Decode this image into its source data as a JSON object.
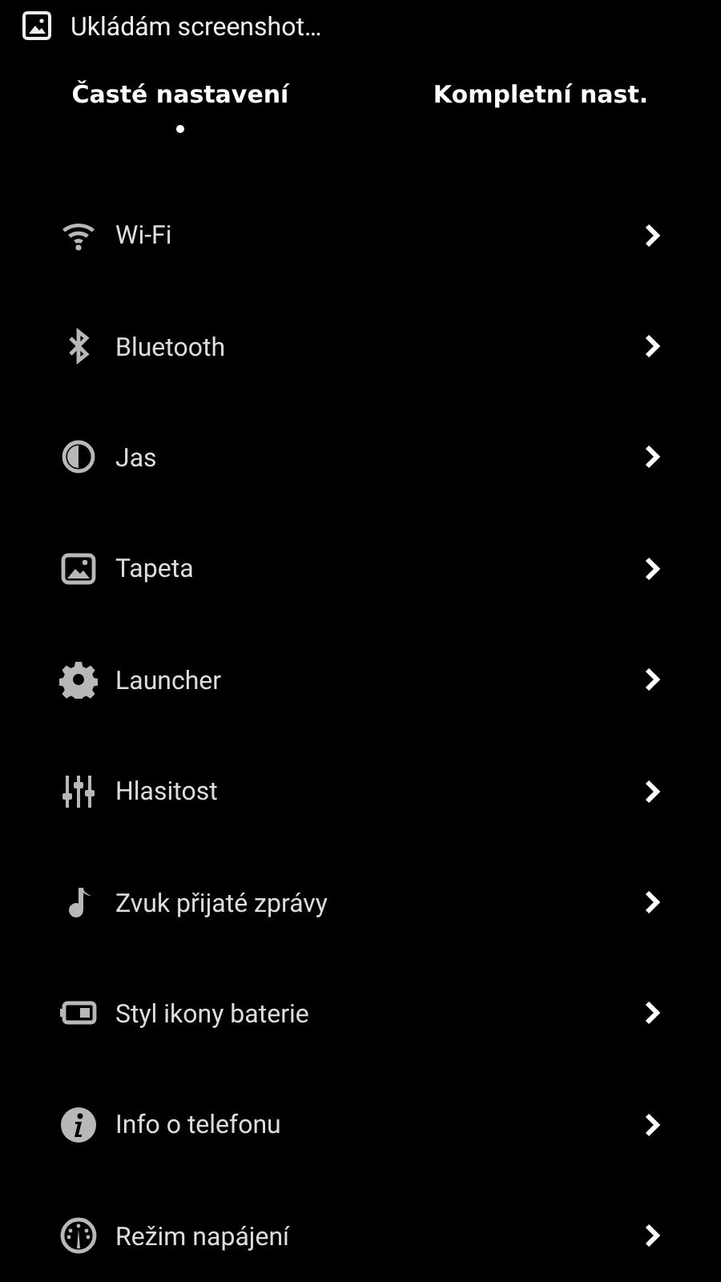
{
  "notification": {
    "text": "Ukládám screenshot…"
  },
  "tabs": [
    {
      "label": "Časté nastavení",
      "selected": true
    },
    {
      "label": "Kompletní nast.",
      "selected": false
    }
  ],
  "items": [
    {
      "label": "Wi-Fi"
    },
    {
      "label": "Bluetooth"
    },
    {
      "label": "Jas"
    },
    {
      "label": "Tapeta"
    },
    {
      "label": "Launcher"
    },
    {
      "label": "Hlasitost"
    },
    {
      "label": "Zvuk přijaté zprávy"
    },
    {
      "label": "Styl ikony baterie"
    },
    {
      "label": "Info o telefonu"
    },
    {
      "label": "Režim napájení"
    }
  ]
}
